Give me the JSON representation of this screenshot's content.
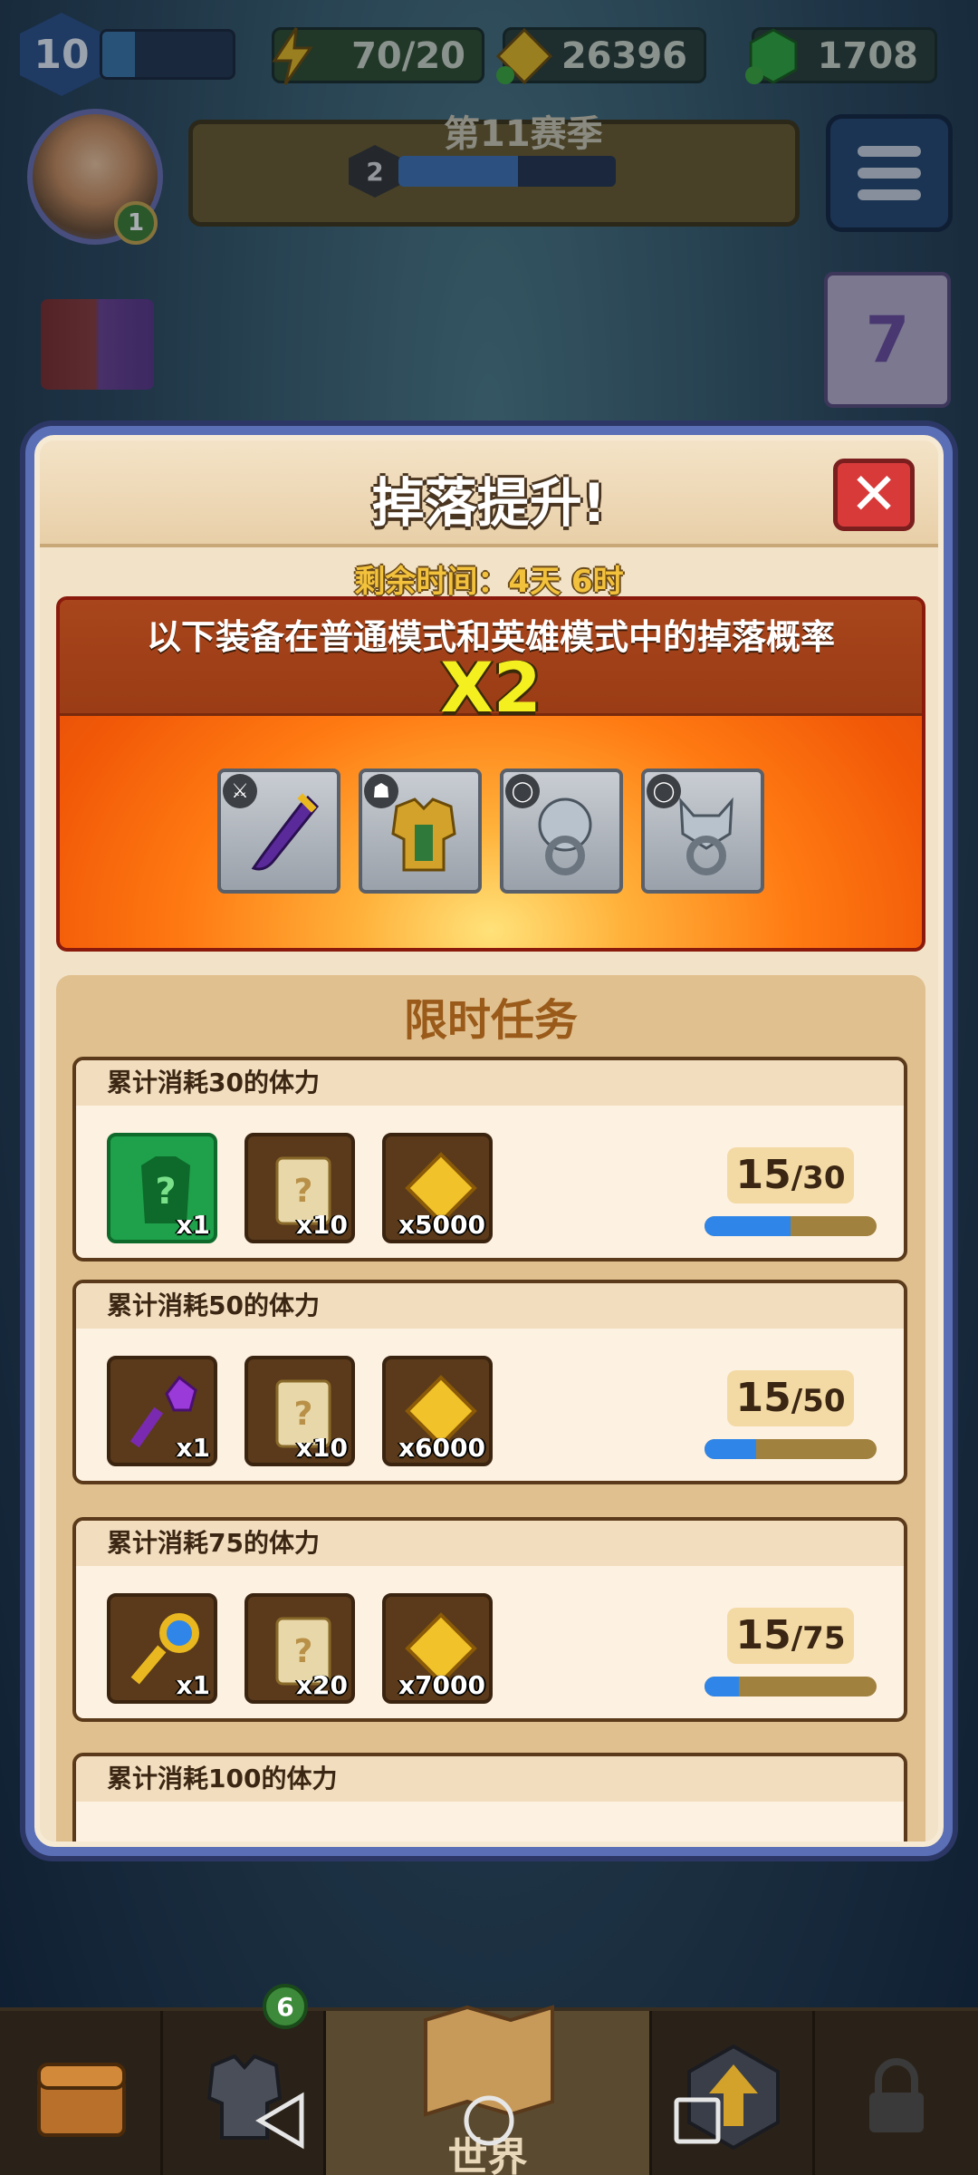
{
  "hud": {
    "level": "10",
    "energy": "70/20",
    "gold": "26396",
    "gems": "1708",
    "avatar_badge": "1",
    "season_title": "第11赛季",
    "season_rank": "2",
    "calendar_day": "7"
  },
  "modal": {
    "title": "掉落提升!",
    "close_label": "✕",
    "timer": "剩余时间：4天 6时",
    "boost_text": "以下装备在普通模式和英雄模式中的掉落概率",
    "multiplier": "X2",
    "equipment": [
      {
        "name": "sword-icon",
        "tag": "⚔"
      },
      {
        "name": "armor-icon",
        "tag": "☗"
      },
      {
        "name": "lion-ring-icon",
        "tag": "◯"
      },
      {
        "name": "wolf-ring-icon",
        "tag": "◯"
      }
    ],
    "tasks_title": "限时任务",
    "tasks": [
      {
        "title": "累计消耗30的体力",
        "rewards": [
          "x1",
          "x10",
          "x5000"
        ],
        "progress": "15",
        "total": "/30",
        "fill": 0.5
      },
      {
        "title": "累计消耗50的体力",
        "rewards": [
          "x1",
          "x10",
          "x6000"
        ],
        "progress": "15",
        "total": "/50",
        "fill": 0.3
      },
      {
        "title": "累计消耗75的体力",
        "rewards": [
          "x1",
          "x20",
          "x7000"
        ],
        "progress": "15",
        "total": "/75",
        "fill": 0.2
      },
      {
        "title": "累计消耗100的体力"
      }
    ]
  },
  "nav": {
    "world_label": "世界",
    "armor_badge": "6"
  },
  "colors": {
    "progress": "#2f86e8",
    "close": "#d83a3a",
    "multiplier": "#f4f020"
  }
}
